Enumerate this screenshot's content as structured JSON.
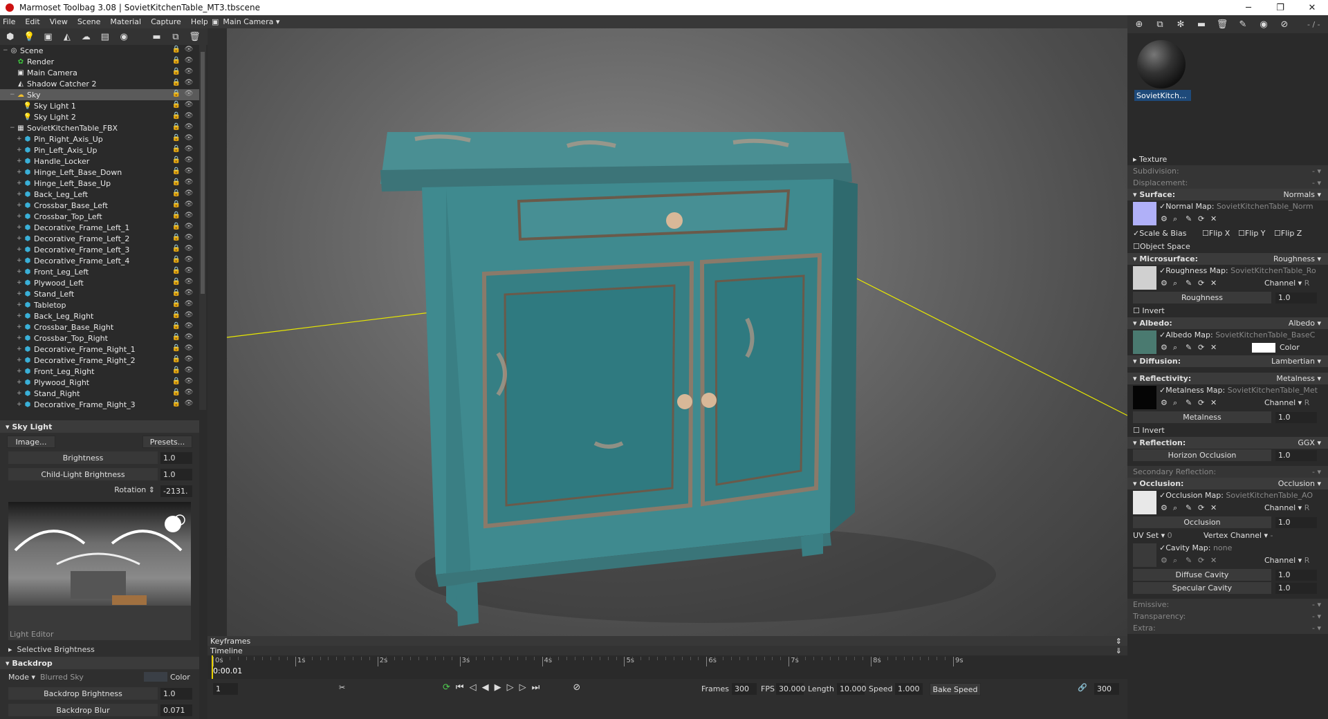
{
  "app": {
    "title": "Marmoset Toolbag 3.08  |  SovietKitchenTable_MT3.tbscene"
  },
  "window_controls": [
    "─",
    "❐",
    "✕"
  ],
  "menu": [
    "File",
    "Edit",
    "View",
    "Scene",
    "Material",
    "Capture",
    "Help"
  ],
  "camera": {
    "label": "Main Camera"
  },
  "outliner": {
    "items": [
      {
        "label": "Scene",
        "depth": 0,
        "icon": "scene"
      },
      {
        "label": "Render",
        "depth": 1,
        "icon": "render"
      },
      {
        "label": "Main Camera",
        "depth": 1,
        "icon": "camera"
      },
      {
        "label": "Shadow Catcher 2",
        "depth": 1,
        "icon": "shadow"
      },
      {
        "label": "Sky",
        "depth": 1,
        "icon": "sky",
        "selected": true
      },
      {
        "label": "Sky Light 1",
        "depth": 2,
        "icon": "light"
      },
      {
        "label": "Sky Light 2",
        "depth": 2,
        "icon": "light"
      },
      {
        "label": "SovietKitchenTable_FBX",
        "depth": 1,
        "icon": "fbx"
      },
      {
        "label": "Pin_Right_Axis_Up",
        "depth": 2,
        "icon": "mesh"
      },
      {
        "label": "Pin_Left_Axis_Up",
        "depth": 2,
        "icon": "mesh"
      },
      {
        "label": "Handle_Locker",
        "depth": 2,
        "icon": "mesh"
      },
      {
        "label": "Hinge_Left_Base_Down",
        "depth": 2,
        "icon": "mesh"
      },
      {
        "label": "Hinge_Left_Base_Up",
        "depth": 2,
        "icon": "mesh"
      },
      {
        "label": "Back_Leg_Left",
        "depth": 2,
        "icon": "mesh"
      },
      {
        "label": "Crossbar_Base_Left",
        "depth": 2,
        "icon": "mesh"
      },
      {
        "label": "Crossbar_Top_Left",
        "depth": 2,
        "icon": "mesh"
      },
      {
        "label": "Decorative_Frame_Left_1",
        "depth": 2,
        "icon": "mesh"
      },
      {
        "label": "Decorative_Frame_Left_2",
        "depth": 2,
        "icon": "mesh"
      },
      {
        "label": "Decorative_Frame_Left_3",
        "depth": 2,
        "icon": "mesh"
      },
      {
        "label": "Decorative_Frame_Left_4",
        "depth": 2,
        "icon": "mesh"
      },
      {
        "label": "Front_Leg_Left",
        "depth": 2,
        "icon": "mesh"
      },
      {
        "label": "Plywood_Left",
        "depth": 2,
        "icon": "mesh"
      },
      {
        "label": "Stand_Left",
        "depth": 2,
        "icon": "mesh"
      },
      {
        "label": "Tabletop",
        "depth": 2,
        "icon": "mesh"
      },
      {
        "label": "Back_Leg_Right",
        "depth": 2,
        "icon": "mesh"
      },
      {
        "label": "Crossbar_Base_Right",
        "depth": 2,
        "icon": "mesh"
      },
      {
        "label": "Crossbar_Top_Right",
        "depth": 2,
        "icon": "mesh"
      },
      {
        "label": "Decorative_Frame_Right_1",
        "depth": 2,
        "icon": "mesh"
      },
      {
        "label": "Decorative_Frame_Right_2",
        "depth": 2,
        "icon": "mesh"
      },
      {
        "label": "Front_Leg_Right",
        "depth": 2,
        "icon": "mesh"
      },
      {
        "label": "Plywood_Right",
        "depth": 2,
        "icon": "mesh"
      },
      {
        "label": "Stand_Right",
        "depth": 2,
        "icon": "mesh"
      },
      {
        "label": "Decorative_Frame_Right_3",
        "depth": 2,
        "icon": "mesh"
      }
    ]
  },
  "skylight": {
    "header": "Sky Light",
    "image_btn": "Image...",
    "presets_btn": "Presets...",
    "brightness_label": "Brightness",
    "brightness_val": "1.0",
    "child_label": "Child-Light Brightness",
    "child_val": "1.0",
    "rotation_label": "Rotation",
    "rotation_val": "-2131.",
    "editor_label": "Light Editor",
    "selective": "Selective Brightness"
  },
  "backdrop": {
    "header": "Backdrop",
    "mode_label": "Mode",
    "mode_val": "Blurred Sky",
    "color_label": "Color",
    "brightness_label": "Backdrop Brightness",
    "brightness_val": "1.0",
    "blur_label": "Backdrop Blur",
    "blur_val": "0.071"
  },
  "timeline": {
    "keyframes": "Keyframes",
    "timeline": "Timeline",
    "time": "0:00.01",
    "ticks": [
      "0s",
      "1s",
      "2s",
      "3s",
      "4s",
      "5s",
      "6s",
      "7s",
      "8s",
      "9s"
    ],
    "frame": "1",
    "frames_label": "Frames",
    "frames_val": "300",
    "fps_label": "FPS",
    "fps_val": "30.000",
    "length_label": "Length",
    "length_val": "10.000",
    "speed_label": "Speed",
    "speed_val": "1.000",
    "bake_label": "Bake Speed",
    "end_val": "300"
  },
  "material": {
    "zoom": "- / -",
    "thumb_label": "SovietKitch...",
    "texture": "Texture",
    "subdivision": "Subdivision:",
    "displacement": "Displacement:",
    "surface": {
      "label": "Surface:",
      "mode": "Normals",
      "map_label": "Normal Map:",
      "map_file": "SovietKitchenTable_Norm",
      "scale_bias": "Scale & Bias",
      "flipx": "Flip X",
      "flipy": "Flip Y",
      "flipz": "Flip Z",
      "object_space": "Object Space"
    },
    "micro": {
      "label": "Microsurface:",
      "mode": "Roughness",
      "map_label": "Roughness Map:",
      "map_file": "SovietKitchenTable_Ro",
      "channel": "Channel",
      "channel_val": "R",
      "slider_label": "Roughness",
      "slider_val": "1.0",
      "invert": "Invert"
    },
    "albedo": {
      "label": "Albedo:",
      "mode": "Albedo",
      "map_label": "Albedo Map:",
      "map_file": "SovietKitchenTable_BaseC",
      "color_label": "Color"
    },
    "diffusion": {
      "label": "Diffusion:",
      "mode": "Lambertian"
    },
    "reflectivity": {
      "label": "Reflectivity:",
      "mode": "Metalness",
      "map_label": "Metalness Map:",
      "map_file": "SovietKitchenTable_Met",
      "channel": "Channel",
      "channel_val": "R",
      "slider_label": "Metalness",
      "slider_val": "1.0",
      "invert": "Invert"
    },
    "reflection": {
      "label": "Reflection:",
      "mode": "GGX",
      "slider_label": "Horizon Occlusion",
      "slider_val": "1.0"
    },
    "secondary": "Secondary Reflection:",
    "occlusion": {
      "label": "Occlusion:",
      "mode": "Occlusion",
      "map_label": "Occlusion Map:",
      "map_file": "SovietKitchenTable_AO",
      "channel": "Channel",
      "channel_val": "R",
      "slider_label": "Occlusion",
      "slider_val": "1.0",
      "uvset_label": "UV Set",
      "uvset_val": "0",
      "vertex_label": "Vertex Channel",
      "vertex_val": "-",
      "cavity_label": "Cavity Map:",
      "cavity_file": "none",
      "cavity_channel": "Channel",
      "cavity_channel_val": "R",
      "diffuse_cavity": "Diffuse Cavity",
      "diffuse_cavity_val": "1.0",
      "specular_cavity": "Specular Cavity",
      "specular_cavity_val": "1.0"
    },
    "emissive": "Emissive:",
    "transparency": "Transparency:",
    "extra": "Extra:",
    "dash": "-"
  },
  "colors": {
    "accent": "#1e4a7a",
    "selected": "#5a5a5a",
    "mesh_icon": "#3ab0d8",
    "cabinet": "#3f8f94"
  }
}
